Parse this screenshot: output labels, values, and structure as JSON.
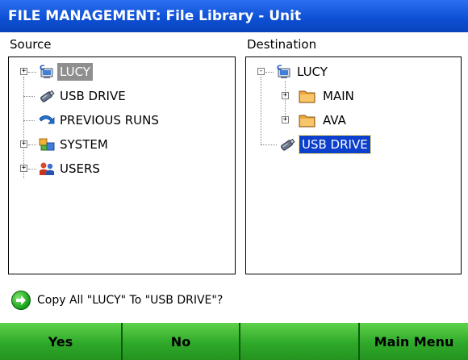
{
  "window": {
    "title": "FILE MANAGEMENT: File Library - Unit"
  },
  "source": {
    "label": "Source",
    "items": [
      {
        "label": "LUCY",
        "icon": "computer-icon",
        "expander": "+",
        "selected": true
      },
      {
        "label": "USB DRIVE",
        "icon": "usb-drive-icon"
      },
      {
        "label": "PREVIOUS RUNS",
        "icon": "previous-runs-icon"
      },
      {
        "label": "SYSTEM",
        "icon": "system-icon",
        "expander": "+"
      },
      {
        "label": "USERS",
        "icon": "users-icon",
        "expander": "+"
      }
    ]
  },
  "destination": {
    "label": "Destination",
    "items": [
      {
        "label": "LUCY",
        "icon": "computer-icon",
        "expander": "-"
      },
      {
        "label": "MAIN",
        "icon": "folder-icon",
        "expander": "+"
      },
      {
        "label": "AVA",
        "icon": "folder-icon",
        "expander": "+"
      },
      {
        "label": "USB DRIVE",
        "icon": "usb-drive-icon",
        "selected": true
      }
    ]
  },
  "prompt": {
    "text": "Copy All \"LUCY\" To \"USB DRIVE\"?",
    "icon": "green-arrow-icon"
  },
  "buttons": {
    "yes": "Yes",
    "no": "No",
    "blank": "",
    "main_menu": "Main Menu"
  },
  "colors": {
    "title_bar": "#0d4fd3",
    "button_green": "#2fa92a",
    "selection_blue": "#0b3fcc",
    "selection_grey": "#8f8f8f"
  }
}
